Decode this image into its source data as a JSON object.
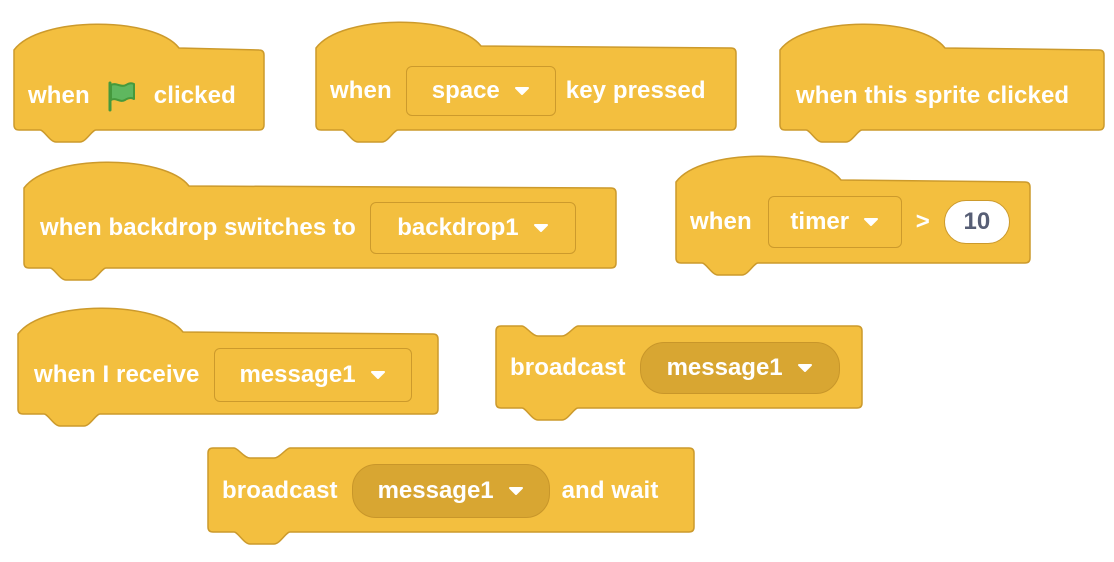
{
  "colors": {
    "block_fill": "#f3bf3f",
    "block_stroke": "#cc9a2c",
    "round_input_fill": "#d8a632",
    "number_text": "#575e75",
    "flag_green": "#5fb75f"
  },
  "blocks": {
    "green_flag": {
      "when": "when",
      "flag_icon": "green-flag-icon",
      "clicked": "clicked"
    },
    "key_pressed": {
      "when": "when",
      "key": "space",
      "suffix": "key pressed"
    },
    "sprite_clicked": {
      "label": "when this sprite clicked"
    },
    "backdrop_switches": {
      "label": "when backdrop switches to",
      "backdrop": "backdrop1"
    },
    "timer_greater": {
      "when": "when",
      "sensor": "timer",
      "operator": ">",
      "value": "10"
    },
    "receive": {
      "label": "when I receive",
      "message": "message1"
    },
    "broadcast": {
      "label": "broadcast",
      "message": "message1"
    },
    "broadcast_wait": {
      "label": "broadcast",
      "message": "message1",
      "suffix": "and wait"
    }
  }
}
